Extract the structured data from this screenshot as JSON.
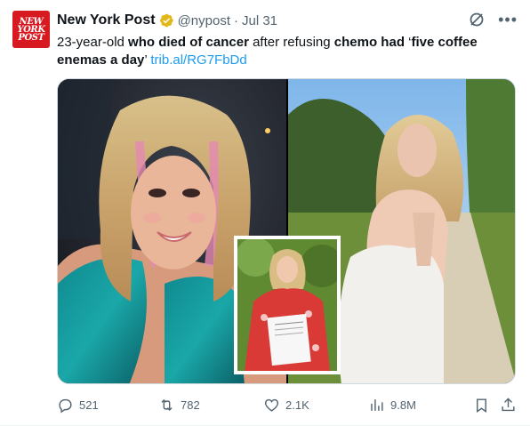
{
  "account": {
    "logo_lines": [
      "NEW",
      "YORK",
      "POST"
    ],
    "name": "New York Post",
    "handle": "@nypost",
    "separator": "·",
    "time": "Jul 31",
    "brand_color": "#d71920",
    "verified_color": "#e2b719"
  },
  "tweet": {
    "text_parts": [
      {
        "t": "23-year-old ",
        "b": false
      },
      {
        "t": "who died of cancer",
        "b": true
      },
      {
        "t": " after refusing ",
        "b": false
      },
      {
        "t": "chemo had",
        "b": true
      },
      {
        "t": " ‘",
        "b": false
      },
      {
        "t": "five coffee enemas a day",
        "b": true
      },
      {
        "t": "’ ",
        "b": false
      }
    ],
    "link": "trib.al/RG7FbDd",
    "link_color": "#1d9bf0"
  },
  "media": {
    "left_photo": "woman-with-pink-highlights-sequined-dress-photo",
    "right_photo": "woman-in-white-dress-on-path-photo",
    "inset_photo": "woman-holding-certificate-photo"
  },
  "metrics": {
    "replies": "521",
    "reposts": "782",
    "likes": "2.1K",
    "views": "9.8M"
  },
  "icons": {
    "reply": "reply-icon",
    "repost": "repost-icon",
    "like": "heart-icon",
    "views": "views-icon",
    "bookmark": "bookmark-icon",
    "share": "share-icon",
    "grok": "grok-icon",
    "more": "more-icon",
    "verified": "verified-badge-icon"
  }
}
